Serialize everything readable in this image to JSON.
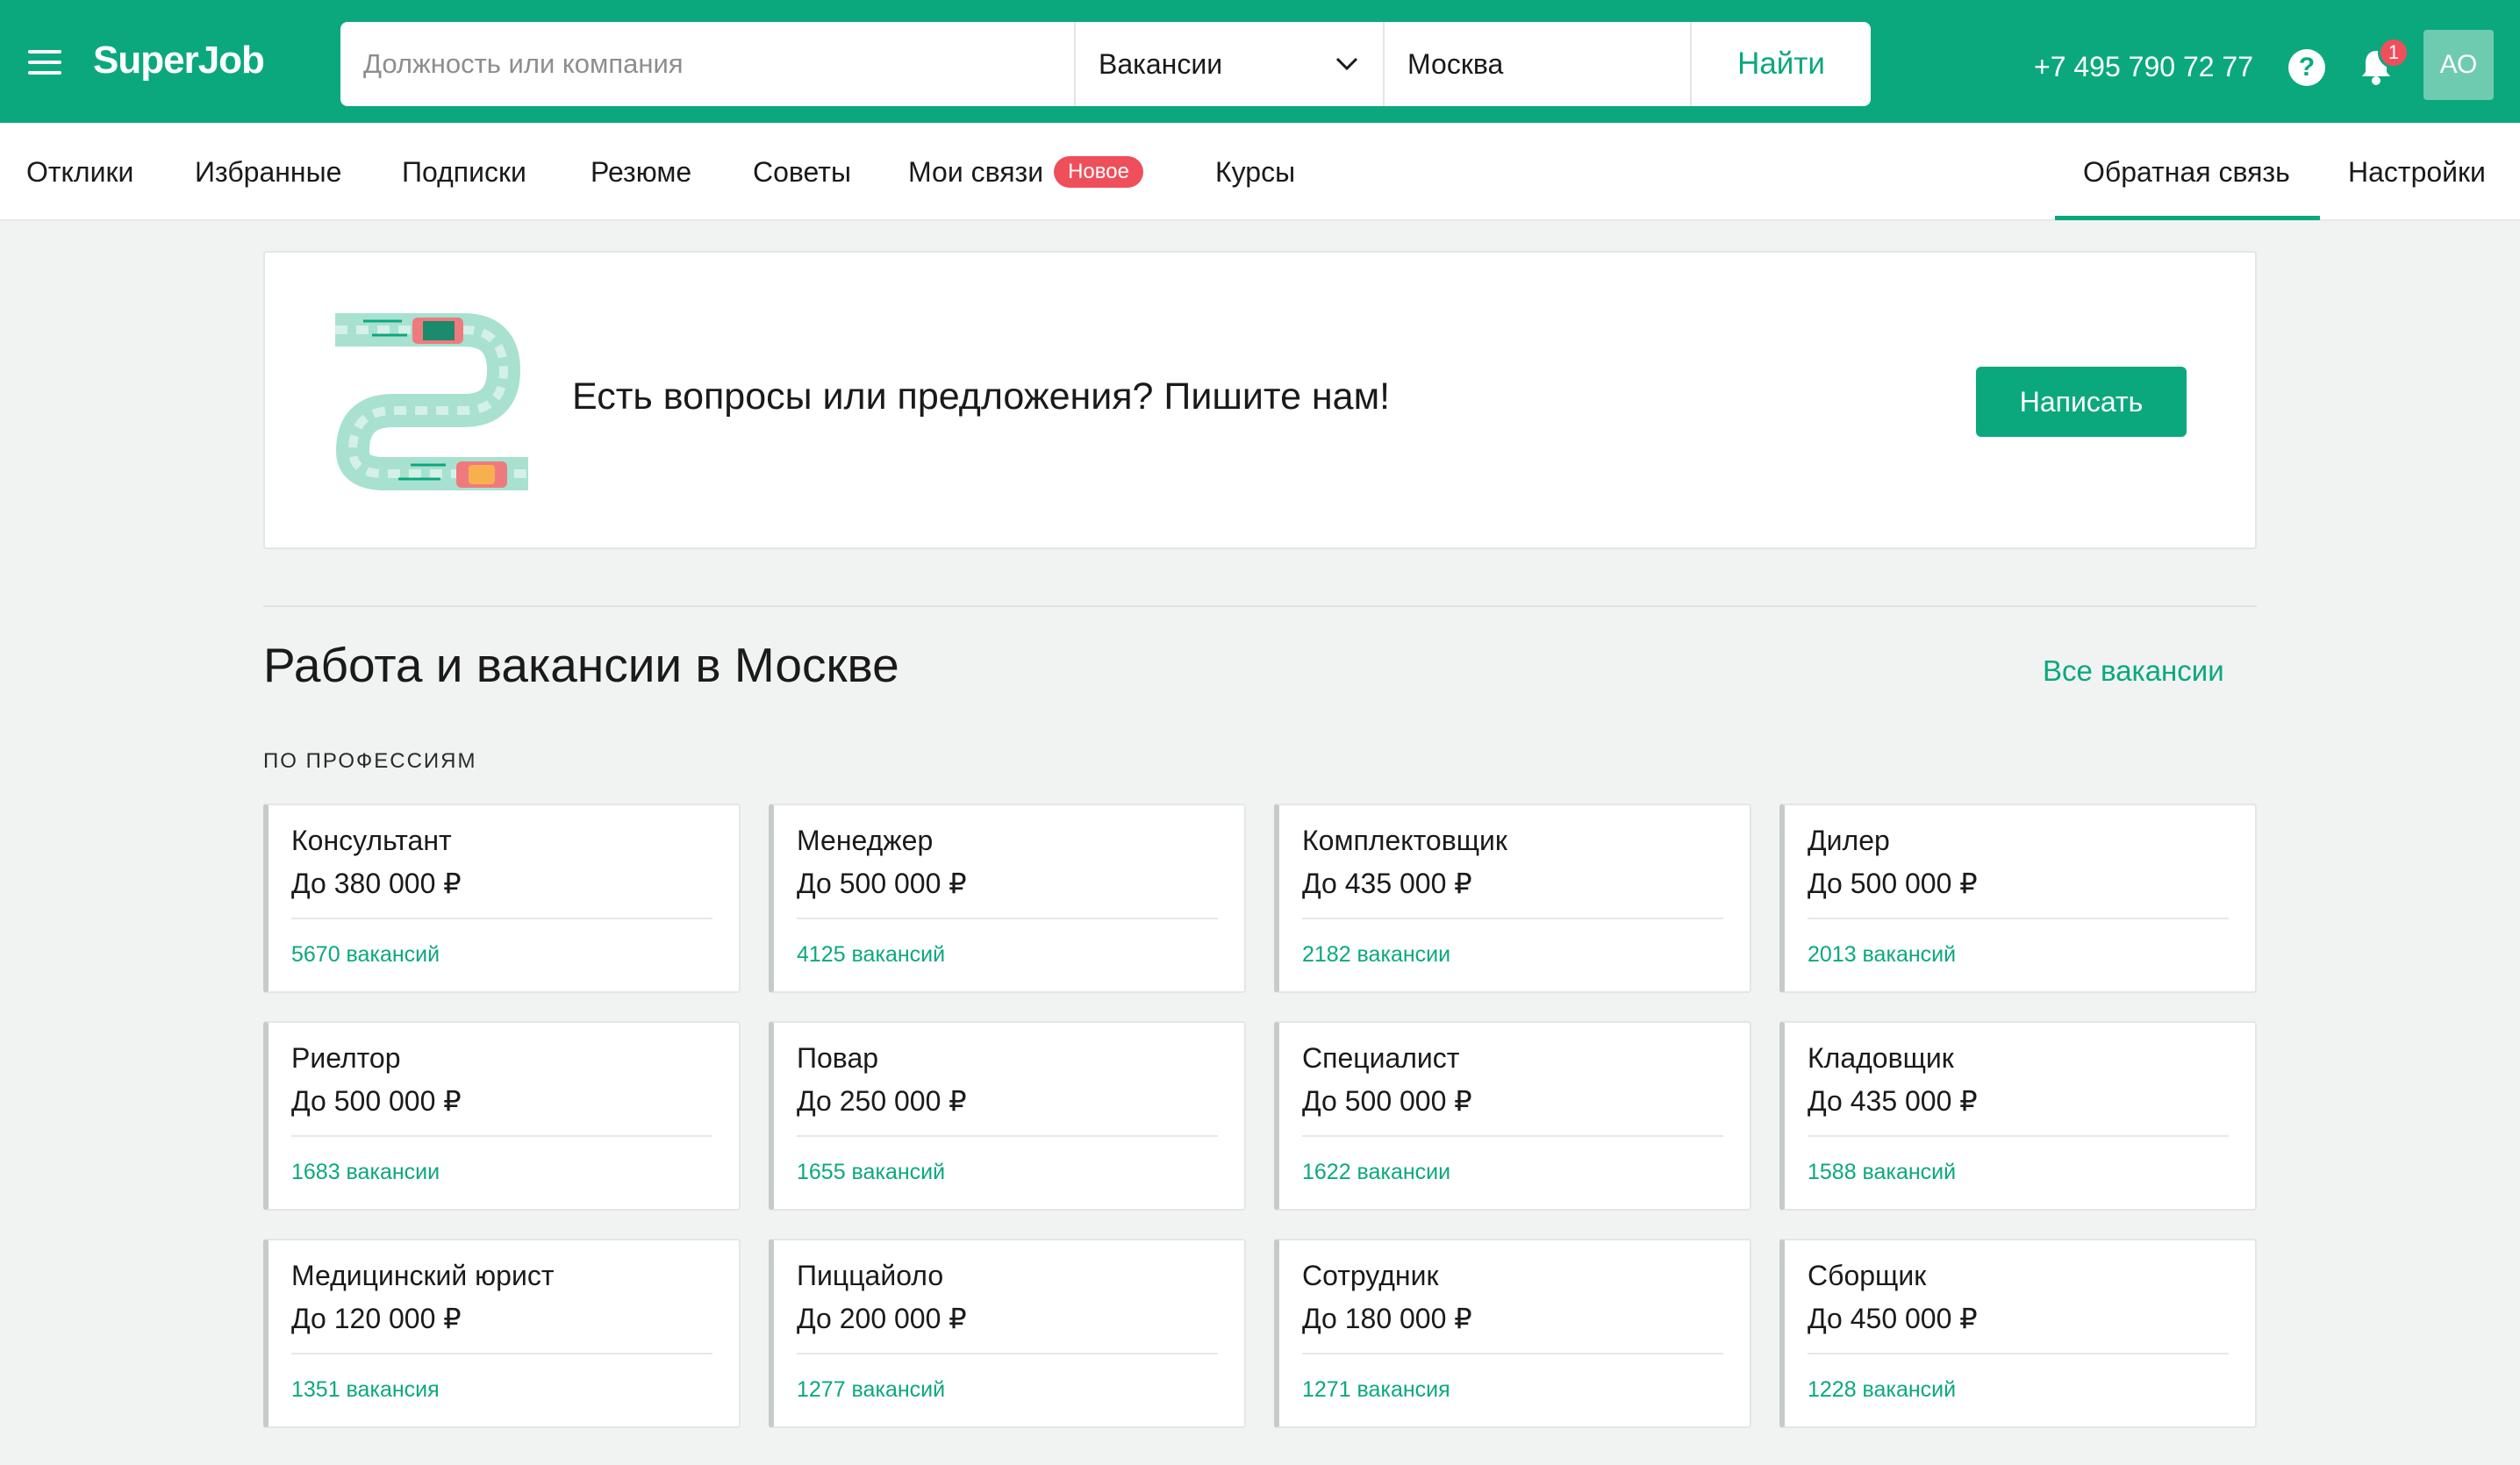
{
  "header": {
    "logo": "SuperJob",
    "search_placeholder": "Должность или компания",
    "search_type": "Вакансии",
    "city": "Москва",
    "find_label": "Найти",
    "phone": "+7 495 790 72 77",
    "help_glyph": "?",
    "notifications_count": "1",
    "avatar_initials": "АО",
    "brand_color": "#0ba87e"
  },
  "nav": {
    "items": [
      "Отклики",
      "Избранные",
      "Подписки",
      "Резюме",
      "Советы",
      "Мои связи",
      "Курсы"
    ],
    "new_badge": "Новое",
    "feedback": "Обратная связь",
    "settings": "Настройки"
  },
  "banner": {
    "text": "Есть вопросы или предложения? Пишите нам!",
    "button": "Написать"
  },
  "section": {
    "title": "Работа и вакансии в Москве",
    "all_link": "Все вакансии",
    "subhead": "ПО ПРОФЕССИЯМ"
  },
  "cards": [
    {
      "title": "Консультант",
      "salary": "До 380 000 ₽",
      "count": "5670 вакансий"
    },
    {
      "title": "Менеджер",
      "salary": "До 500 000 ₽",
      "count": "4125 вакансий"
    },
    {
      "title": "Комплектовщик",
      "salary": "До 435 000 ₽",
      "count": "2182 вакансии"
    },
    {
      "title": "Дилер",
      "salary": "До 500 000 ₽",
      "count": "2013 вакансий"
    },
    {
      "title": "Риелтор",
      "salary": "До 500 000 ₽",
      "count": "1683 вакансии"
    },
    {
      "title": "Повар",
      "salary": "До 250 000 ₽",
      "count": "1655 вакансий"
    },
    {
      "title": "Специалист",
      "salary": "До 500 000 ₽",
      "count": "1622 вакансии"
    },
    {
      "title": "Кладовщик",
      "salary": "До 435 000 ₽",
      "count": "1588 вакансий"
    },
    {
      "title": "Медицинский юрист",
      "salary": "До 120 000 ₽",
      "count": "1351 вакансия"
    },
    {
      "title": "Пиццайоло",
      "salary": "До 200 000 ₽",
      "count": "1277 вакансий"
    },
    {
      "title": "Сотрудник",
      "salary": "До 180 000 ₽",
      "count": "1271 вакансия"
    },
    {
      "title": "Сборщик",
      "salary": "До 450 000 ₽",
      "count": "1228 вакансий"
    }
  ]
}
